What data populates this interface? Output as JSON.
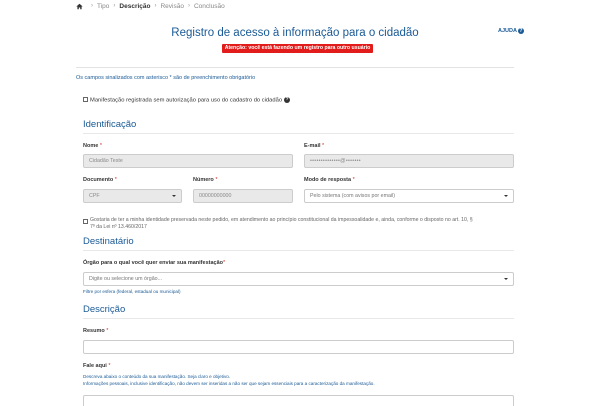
{
  "breadcrumb": {
    "items": [
      "Tipo",
      "Descrição",
      "Revisão",
      "Conclusão"
    ],
    "separator": "›",
    "active_index": 1
  },
  "header": {
    "title": "Registro de acesso à informação para o cidadão",
    "help_label": "AJUDA",
    "help_icon": "?",
    "alert": "Atenção: você está fazendo um registro para outro usuário"
  },
  "required_note": "Os campos sinalizados com asterisco * são de preenchimento obrigatório",
  "unauthorized_checkbox": {
    "label": "Manifestação registrada sem autorização para uso do cadastro do cidadão",
    "checked": false
  },
  "identificacao": {
    "title": "Identificação",
    "nome": {
      "label": "Nome",
      "required": "*",
      "value": "Cidadão Teste"
    },
    "email": {
      "label": "E-mail",
      "required": "*",
      "value": "••••••••••••••@•••••••"
    },
    "documento": {
      "label": "Documento",
      "required": "*",
      "value": "CPF"
    },
    "numero": {
      "label": "Número",
      "required": "*",
      "value": "00000000000"
    },
    "modo_resposta": {
      "label": "Modo de resposta",
      "required": "*",
      "value": "Pelo sistema (com avisos por email)"
    },
    "preserve_identity": {
      "line1": "Gostaria de ter a minha identidade preservada neste pedido, em atendimento ao princípio constitucional da impessoalidade e, ainda, conforme o disposto no art. 10, §",
      "line2": "7º da Lei nº 13.460/2017",
      "checked": false
    }
  },
  "destinatario": {
    "title": "Destinatário",
    "orgao": {
      "label": "Órgão para o qual você quer enviar sua manifestação",
      "required": "*",
      "placeholder": "Digite ou selecione um órgão...",
      "hint": "Filtre por esfera (federal, estadual ou municipal)"
    }
  },
  "descricao": {
    "title": "Descrição",
    "resumo": {
      "label": "Resumo",
      "required": "*",
      "value": ""
    },
    "fale_aqui": {
      "label": "Fale aqui",
      "required": "*",
      "help_line1": "Descreva abaixo o conteúdo da sua manifestação. Seja claro e objetivo.",
      "help_line2": "Informações pessoais, inclusive identificação, não devem ser inseridas a não ser que sejam essenciais para a caracterização da manifestação."
    }
  },
  "colors": {
    "primary": "#1a5a96",
    "alert": "#e21b1b",
    "required": "#d9261c",
    "disabled_field": "#e9e9e9"
  }
}
